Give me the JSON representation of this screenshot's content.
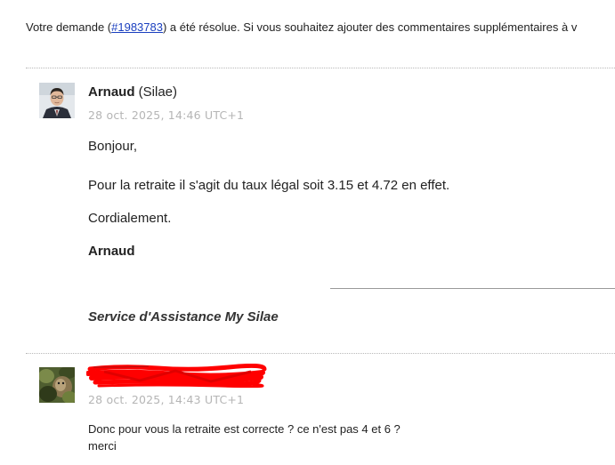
{
  "notice": {
    "prefix": "Votre demande (",
    "ticket_link": "#1983783",
    "suffix": ") a été résolue. Si vous souhaitez ajouter des commentaires supplémentaires à v"
  },
  "comments": [
    {
      "author_name": "Arnaud",
      "author_org": "(Silae)",
      "timestamp": "28 oct. 2025, 14:46 UTC+1",
      "paragraphs": [
        "Bonjour,",
        "Pour la retraite il s'agit du taux légal soit 3.15 et 4.72 en effet.",
        "Cordialement.",
        "Arnaud"
      ],
      "signature": "Service d'Assistance My Silae"
    },
    {
      "author_name": "",
      "timestamp": "28 oct. 2025, 14:43 UTC+1",
      "lines": [
        "Donc pour vous la retraite est correcte ? ce n'est pas 4 et 6 ?",
        "merci"
      ]
    }
  ],
  "colors": {
    "link": "#1a3fbf",
    "timestamp": "#b5b5b5",
    "redaction": "#ff0000"
  }
}
